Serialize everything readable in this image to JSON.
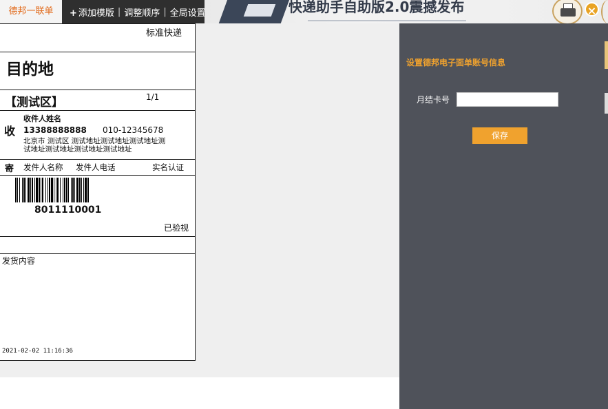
{
  "tabs": {
    "active_label": "德邦一联单"
  },
  "toolbar": {
    "add_template_label": "添加模版",
    "reorder_label": "调整顺序",
    "global_settings_label": "全局设置",
    "separator": "|"
  },
  "banner": {
    "headline": "快递助手自助版2.0震撼发布"
  },
  "label": {
    "service_type": "标准快递",
    "destination_title": "目的地",
    "area": "【测试区】",
    "page_count": "1/1",
    "receive_char": "收",
    "recipient_name": "收件人姓名",
    "recipient_mobile": "13388888888",
    "recipient_phone": "010-12345678",
    "recipient_address_line1": "北京市 测试区 测试地址测试地址测试地址测",
    "recipient_address_line2": "试地址测试地址测试地址测试地址",
    "send_char": "寄",
    "sender_name": "发件人名称",
    "sender_phone": "发件人电话",
    "real_name": "实名认证",
    "tracking_number": "8011110001",
    "inspected": "已验视",
    "contents_label": "发货内容",
    "timestamp": "2021-02-02 11:16:36"
  },
  "panel": {
    "title": "设置德邦电子面单账号信息",
    "card_label": "月结卡号",
    "card_value": "",
    "save_label": "保存"
  },
  "colors": {
    "accent": "#f0a22e",
    "active_tab_text": "#e26b1c",
    "panel_bg": "#4f525a",
    "topbar_bg": "#2f2f2f"
  }
}
